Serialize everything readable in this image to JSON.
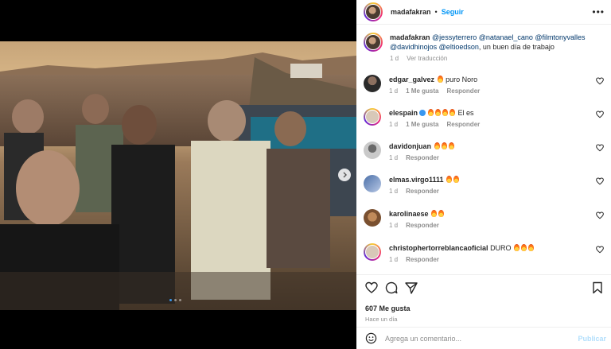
{
  "post": {
    "author": "madafakran",
    "follow_label": "Seguir",
    "more_label": "•••"
  },
  "colors": {
    "accent": "#0095f6",
    "meta": "#8e8e8e",
    "text": "#262626",
    "mention": "#00376b"
  },
  "caption": {
    "author": "madafakran",
    "mentions_line": "@jessyterrero @natanael_cano @filmtonyvalles @davidhinojos @eltioedson",
    "text": ", un buen día de trabajo",
    "time": "1 d",
    "translate": "Ver traducción"
  },
  "comments": [
    {
      "user": "edgar_galvez",
      "text": "puro Noro",
      "emojis": 1,
      "emojis_after": 0,
      "time": "1 d",
      "likes": "1 Me gusta",
      "reply": "Responder"
    },
    {
      "user": "elespain",
      "verified": true,
      "text": "El es",
      "emojis": 4,
      "emojis_after": 0,
      "time": "1 d",
      "likes": "1 Me gusta",
      "reply": "Responder"
    },
    {
      "user": "davidonjuan",
      "text": "",
      "emojis": 3,
      "emojis_after": 0,
      "time": "1 d",
      "likes": "",
      "reply": "Responder"
    },
    {
      "user": "elmas.virgo1111",
      "text": "",
      "emojis": 2,
      "emojis_after": 0,
      "time": "1 d",
      "likes": "",
      "reply": "Responder"
    },
    {
      "user": "karolinaese",
      "text": "",
      "emojis": 2,
      "emojis_after": 0,
      "time": "1 d",
      "likes": "",
      "reply": "Responder"
    },
    {
      "user": "christophertorreblancaoficial",
      "text": "DURO",
      "emojis": 0,
      "emojis_after": 3,
      "time": "1 d",
      "likes": "",
      "reply": "Responder"
    }
  ],
  "engagement": {
    "likes": "607 Me gusta",
    "ago": "Hace un día"
  },
  "composer": {
    "placeholder": "Agrega un comentario...",
    "publish": "Publicar"
  },
  "carousel": {
    "slides": 3,
    "current": 1
  }
}
